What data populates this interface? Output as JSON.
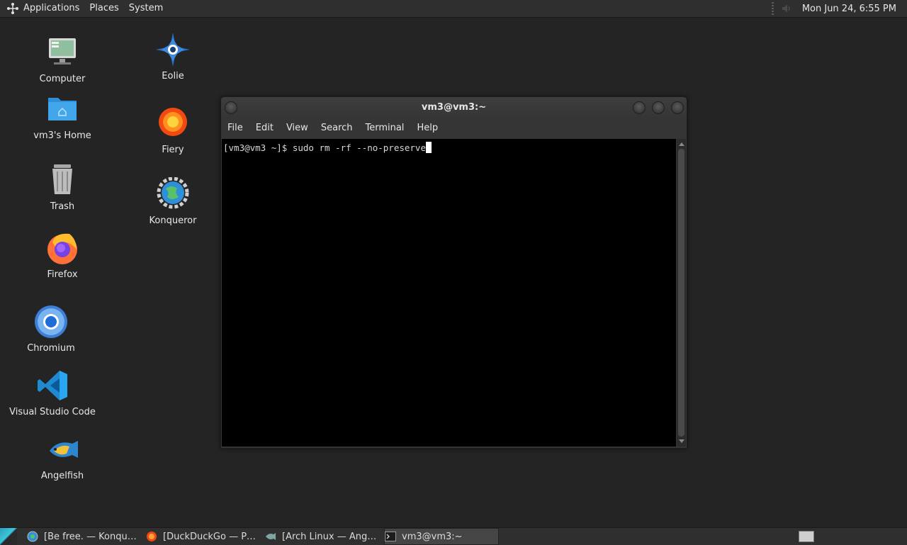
{
  "top_panel": {
    "menus": [
      {
        "label": "Applications"
      },
      {
        "label": "Places"
      },
      {
        "label": "System"
      }
    ],
    "clock": "Mon Jun 24,  6:55 PM"
  },
  "desktop": {
    "icons": [
      {
        "label": "Computer",
        "icon": "computer-icon"
      },
      {
        "label": "vm3's Home",
        "icon": "home-folder-icon"
      },
      {
        "label": "Trash",
        "icon": "trash-icon"
      },
      {
        "label": "Firefox",
        "icon": "firefox-icon"
      },
      {
        "label": "Chromium",
        "icon": "chromium-icon"
      },
      {
        "label": "Visual Studio Code",
        "icon": "vscode-icon"
      },
      {
        "label": "Angelfish",
        "icon": "angelfish-icon"
      },
      {
        "label": "Eolie",
        "icon": "eolie-icon"
      },
      {
        "label": "Fiery",
        "icon": "fiery-icon"
      },
      {
        "label": "Konqueror",
        "icon": "konqueror-icon"
      }
    ]
  },
  "terminal": {
    "title": "vm3@vm3:~",
    "menus": [
      {
        "label": "File"
      },
      {
        "label": "Edit"
      },
      {
        "label": "View"
      },
      {
        "label": "Search"
      },
      {
        "label": "Terminal"
      },
      {
        "label": "Help"
      }
    ],
    "prompt": "[vm3@vm3 ~]$ ",
    "command": "sudo rm -rf --no-preserve"
  },
  "taskbar": {
    "tasks": [
      {
        "label": "[Be free. — Konquer…",
        "icon": "konqueror-icon",
        "active": false
      },
      {
        "label": "[DuckDuckGo — Pri…",
        "icon": "fiery-icon",
        "active": false
      },
      {
        "label": "[Arch Linux — Angel…",
        "icon": "angelfish-icon",
        "active": false
      },
      {
        "label": "vm3@vm3:~",
        "icon": "terminal-icon",
        "active": true
      }
    ]
  },
  "colors": {
    "desktop_bg": "#242424",
    "panel_bg": "#2f2f2f",
    "terminal_bg": "#000000",
    "accent": "#2b9fbf"
  }
}
